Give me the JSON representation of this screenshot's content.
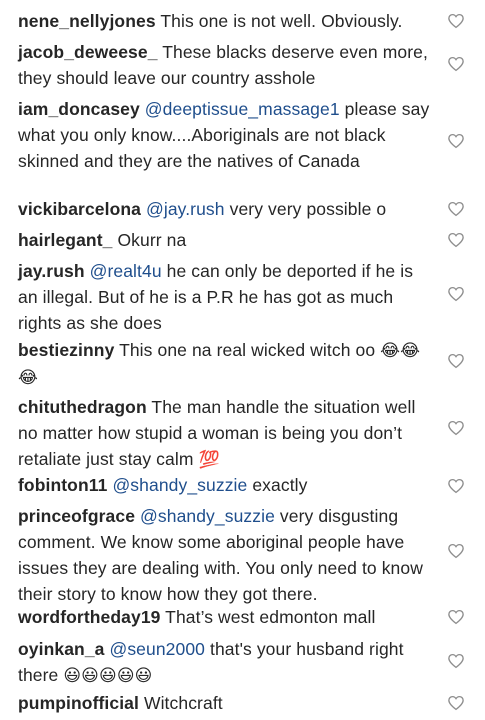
{
  "comments": [
    {
      "user": "nene_nellyjones",
      "mention": "",
      "text": "This one is not well. Obviously.",
      "emoji": ""
    },
    {
      "user": "jacob_deweese_",
      "mention": "",
      "text": "These blacks deserve even more, they should leave our country asshole",
      "emoji": ""
    },
    {
      "user": "iam_doncasey",
      "mention": "@deeptissue_massage1",
      "text": "please say what you only know....Aboriginals are not black skinned and they are the natives of Canada",
      "emoji": ""
    },
    {
      "user": "vickibarcelona",
      "mention": "@jay.rush",
      "text": "very very possible o",
      "emoji": ""
    },
    {
      "user": "hairlegant_",
      "mention": "",
      "text": "Okurr na",
      "emoji": ""
    },
    {
      "user": "jay.rush",
      "mention": "@realt4u",
      "text": "he can only be deported if he is an illegal. But of he is a P.R he has got as much rights as she does",
      "emoji": ""
    },
    {
      "user": "bestiezinny",
      "mention": "",
      "text": "This one na real wicked witch oo",
      "emoji": "😂😂😂"
    },
    {
      "user": "chituthedragon",
      "mention": "",
      "text": "The man handle the situation well no matter how stupid a woman is being you don’t retaliate just stay calm",
      "emoji": "💯"
    },
    {
      "user": "fobinton11",
      "mention": "@shandy_suzzie",
      "text": "exactly",
      "emoji": ""
    },
    {
      "user": "princeofgrace",
      "mention": "@shandy_suzzie",
      "text": "very disgusting comment. We know some aboriginal people have issues they are dealing with. You only need to know their story to know how they got there.",
      "emoji": ""
    },
    {
      "user": "wordfortheday19",
      "mention": "",
      "text": "That’s west edmonton mall",
      "emoji": ""
    },
    {
      "user": "oyinkan_a",
      "mention": "@seun2000",
      "text": "that's your husband right there",
      "emoji": "😃😃😃😃😃"
    },
    {
      "user": "pumpinofficial",
      "mention": "",
      "text": "Witchcraft",
      "emoji": ""
    }
  ],
  "like_icon": "heart-outline-icon",
  "colors": {
    "username": "#262626",
    "mention": "#1f4e8c",
    "text": "#262626",
    "icon": "#8e8e8e"
  }
}
